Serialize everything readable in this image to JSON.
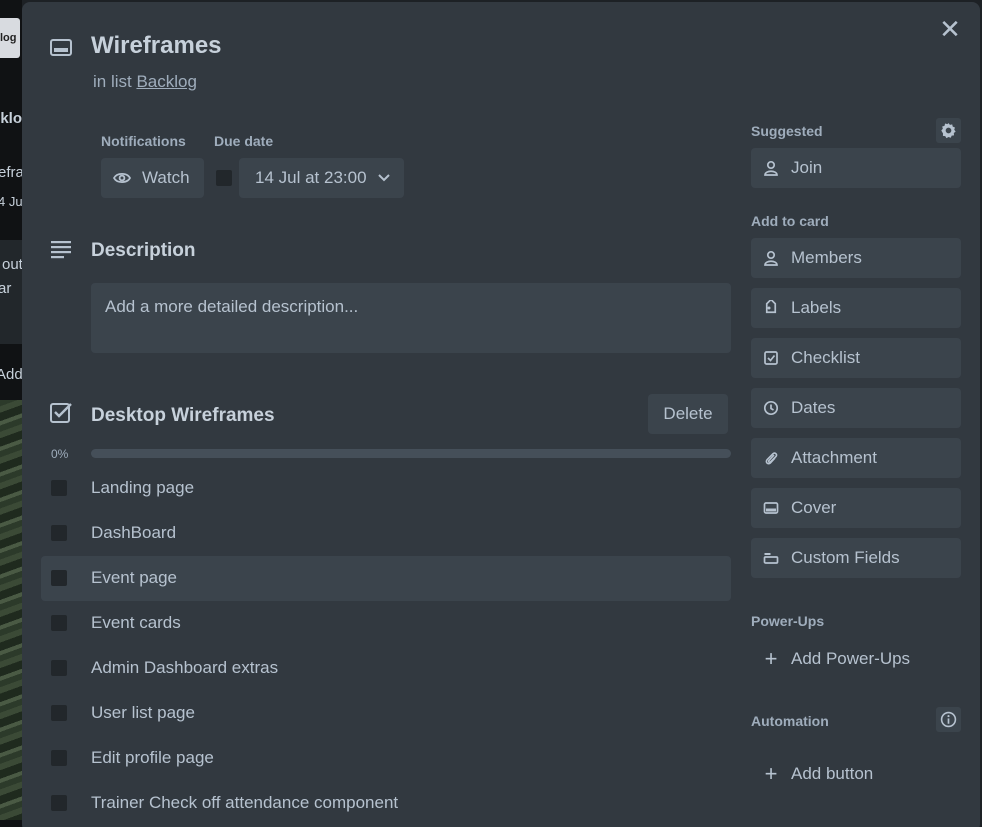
{
  "backdrop": {
    "logo_text": "log",
    "strip_texts": [
      "cklog",
      "efra",
      "4 Ju",
      "out",
      "ar",
      "Add"
    ]
  },
  "card": {
    "title": "Wireframes",
    "list_prefix": "in list",
    "list_name": "Backlog",
    "close_icon": "close-icon"
  },
  "notifications": {
    "label": "Notifications",
    "watch_label": "Watch"
  },
  "due_date": {
    "label": "Due date",
    "value": "14 Jul at 23:00",
    "completed": false
  },
  "description": {
    "title": "Description",
    "placeholder": "Add a more detailed description..."
  },
  "checklist": {
    "title": "Desktop Wireframes",
    "delete_label": "Delete",
    "progress_text": "0%",
    "progress": 0,
    "progress_color": "#4bce97",
    "items": [
      {
        "label": "Landing page",
        "checked": false
      },
      {
        "label": "DashBoard",
        "checked": false
      },
      {
        "label": "Event page",
        "checked": false
      },
      {
        "label": "Event cards",
        "checked": false
      },
      {
        "label": "Admin Dashboard extras",
        "checked": false
      },
      {
        "label": "User list page",
        "checked": false
      },
      {
        "label": "Edit profile page",
        "checked": false
      },
      {
        "label": "Trainer Check off attendance component",
        "checked": false
      }
    ]
  },
  "sidebar": {
    "suggested_label": "Suggested",
    "join_label": "Join",
    "add_to_card_label": "Add to card",
    "add_items": [
      {
        "label": "Members",
        "icon": "person-icon"
      },
      {
        "label": "Labels",
        "icon": "tag-icon"
      },
      {
        "label": "Checklist",
        "icon": "checklist-icon"
      },
      {
        "label": "Dates",
        "icon": "clock-icon"
      },
      {
        "label": "Attachment",
        "icon": "paperclip-icon"
      },
      {
        "label": "Cover",
        "icon": "cover-icon"
      },
      {
        "label": "Custom Fields",
        "icon": "custom-fields-icon"
      }
    ],
    "powerups_label": "Power-Ups",
    "add_powerups_label": "Add Power-Ups",
    "automation_label": "Automation",
    "add_button_label": "Add button"
  },
  "colors": {
    "modal_bg": "#323940",
    "button_bg": "#3b444c",
    "text": "#b6c2cf"
  }
}
